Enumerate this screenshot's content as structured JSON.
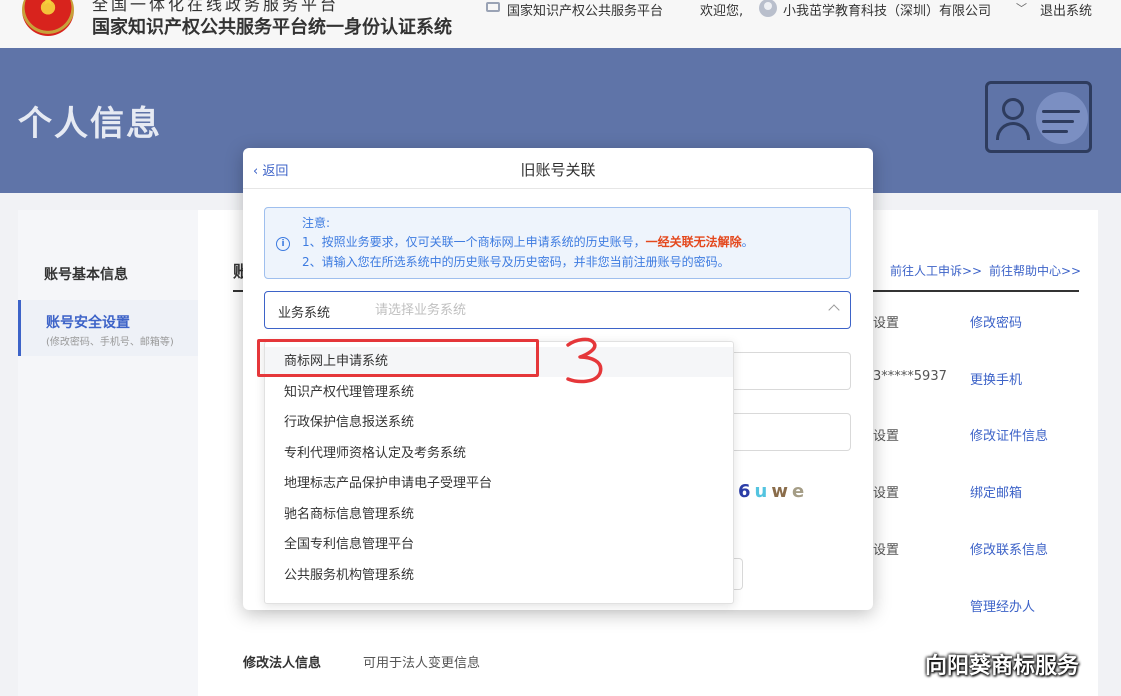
{
  "header": {
    "site_line1": "全国一体化在线政务服务平台",
    "site_line2": "国家知识产权公共服务平台统一身份认证系统",
    "platform_link": "国家知识产权公共服务平台",
    "welcome": "欢迎您,",
    "company": "小我茁学教育科技（深圳）有限公司",
    "logout": "退出系统"
  },
  "banner": {
    "title": "个人信息"
  },
  "sidebar": {
    "items": [
      {
        "label": "账号基本信息"
      },
      {
        "label": "账号安全设置",
        "sub": "(修改密码、手机号、邮箱等)"
      }
    ]
  },
  "main": {
    "section_head": "账",
    "links": {
      "appeal": "前往人工申诉>>",
      "help": "前往帮助中心>>"
    },
    "rows": [
      {
        "status": "设置",
        "action": "修改密码"
      },
      {
        "status": "3*****5937",
        "action": "更换手机"
      },
      {
        "status": "设置",
        "action": "修改证件信息"
      },
      {
        "status": "设置",
        "action": "绑定邮箱"
      },
      {
        "status": "设置",
        "action": "修改联系信息"
      },
      {
        "status": "",
        "action": "管理经办人"
      }
    ],
    "legal": {
      "title": "修改法人信息",
      "desc": "可用于法人变更信息"
    }
  },
  "modal": {
    "back": "返回",
    "title": "旧账号关联",
    "notice": {
      "title": "注意:",
      "line1_prefix": "1、按照业务要求，仅可关联一个商标网上申请系统的历史账号，",
      "line1_warn": "一经关联无法解除",
      "line1_suffix": "。",
      "line2": "2、请输入您在所选系统中的历史账号及历史密码，并非您当前注册账号的密码。"
    },
    "select": {
      "label": "业务系统",
      "placeholder": "请选择业务系统"
    },
    "captcha": [
      "6",
      "u",
      "w",
      "e"
    ]
  },
  "dropdown": {
    "options": [
      "商标网上申请系统",
      "知识产权代理管理系统",
      "行政保护信息报送系统",
      "专利代理师资格认定及考务系统",
      "地理标志产品保护申请电子受理平台",
      "驰名商标信息管理系统",
      "全国专利信息管理平台",
      "公共服务机构管理系统"
    ]
  },
  "annotation": {
    "step": "3"
  },
  "watermark": "向阳葵商标服务",
  "colors": {
    "banner": "#5f74a8",
    "accent": "#3d63c8",
    "warn": "#e4481d",
    "highlight": "#e5373a"
  }
}
